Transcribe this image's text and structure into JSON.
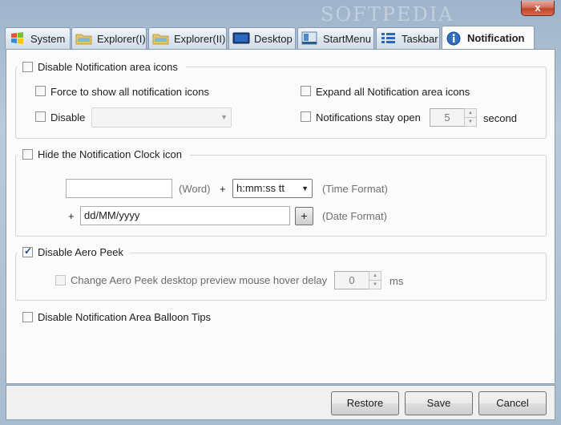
{
  "window": {
    "close_label": "x",
    "watermark": "SOFTPEDIA"
  },
  "tabs": [
    {
      "label": "System",
      "icon": "windows-logo-icon"
    },
    {
      "label": "Explorer(I)",
      "icon": "folder-icon"
    },
    {
      "label": "Explorer(II)",
      "icon": "folder-icon"
    },
    {
      "label": "Desktop",
      "icon": "monitor-icon"
    },
    {
      "label": "StartMenu",
      "icon": "start-menu-icon"
    },
    {
      "label": "Taskbar",
      "icon": "list-icon"
    },
    {
      "label": "Notification",
      "icon": "info-icon",
      "active": true
    }
  ],
  "notification_icons": {
    "title": "Disable Notification area icons",
    "force_show": "Force to show all notification icons",
    "expand_all": "Expand all Notification area icons",
    "disable_label": "Disable",
    "disable_select_value": "",
    "stay_open_label": "Notifications stay open",
    "stay_open_value": "5",
    "stay_open_unit": "second"
  },
  "clock": {
    "title": "Hide the Notification Clock icon",
    "word_value": "",
    "word_label": "(Word)",
    "plus1": "+",
    "time_format_value": "h:mm:ss tt",
    "time_format_label": "(Time Format)",
    "plus2": "+",
    "date_format_value": "dd/MM/yyyy",
    "date_add_button": "+",
    "date_format_label": "(Date Format)"
  },
  "aero_peek": {
    "title": "Disable Aero Peek",
    "checked": true,
    "hover_delay_label": "Change Aero Peek desktop preview mouse hover delay",
    "hover_delay_value": "0",
    "hover_delay_unit": "ms"
  },
  "balloon": {
    "label": "Disable Notification Area Balloon Tips"
  },
  "footer": {
    "restore": "Restore",
    "save": "Save",
    "cancel": "Cancel"
  },
  "colors": {
    "accent": "#3c7fb1",
    "tab_active_bg": "#fbfbfb"
  }
}
